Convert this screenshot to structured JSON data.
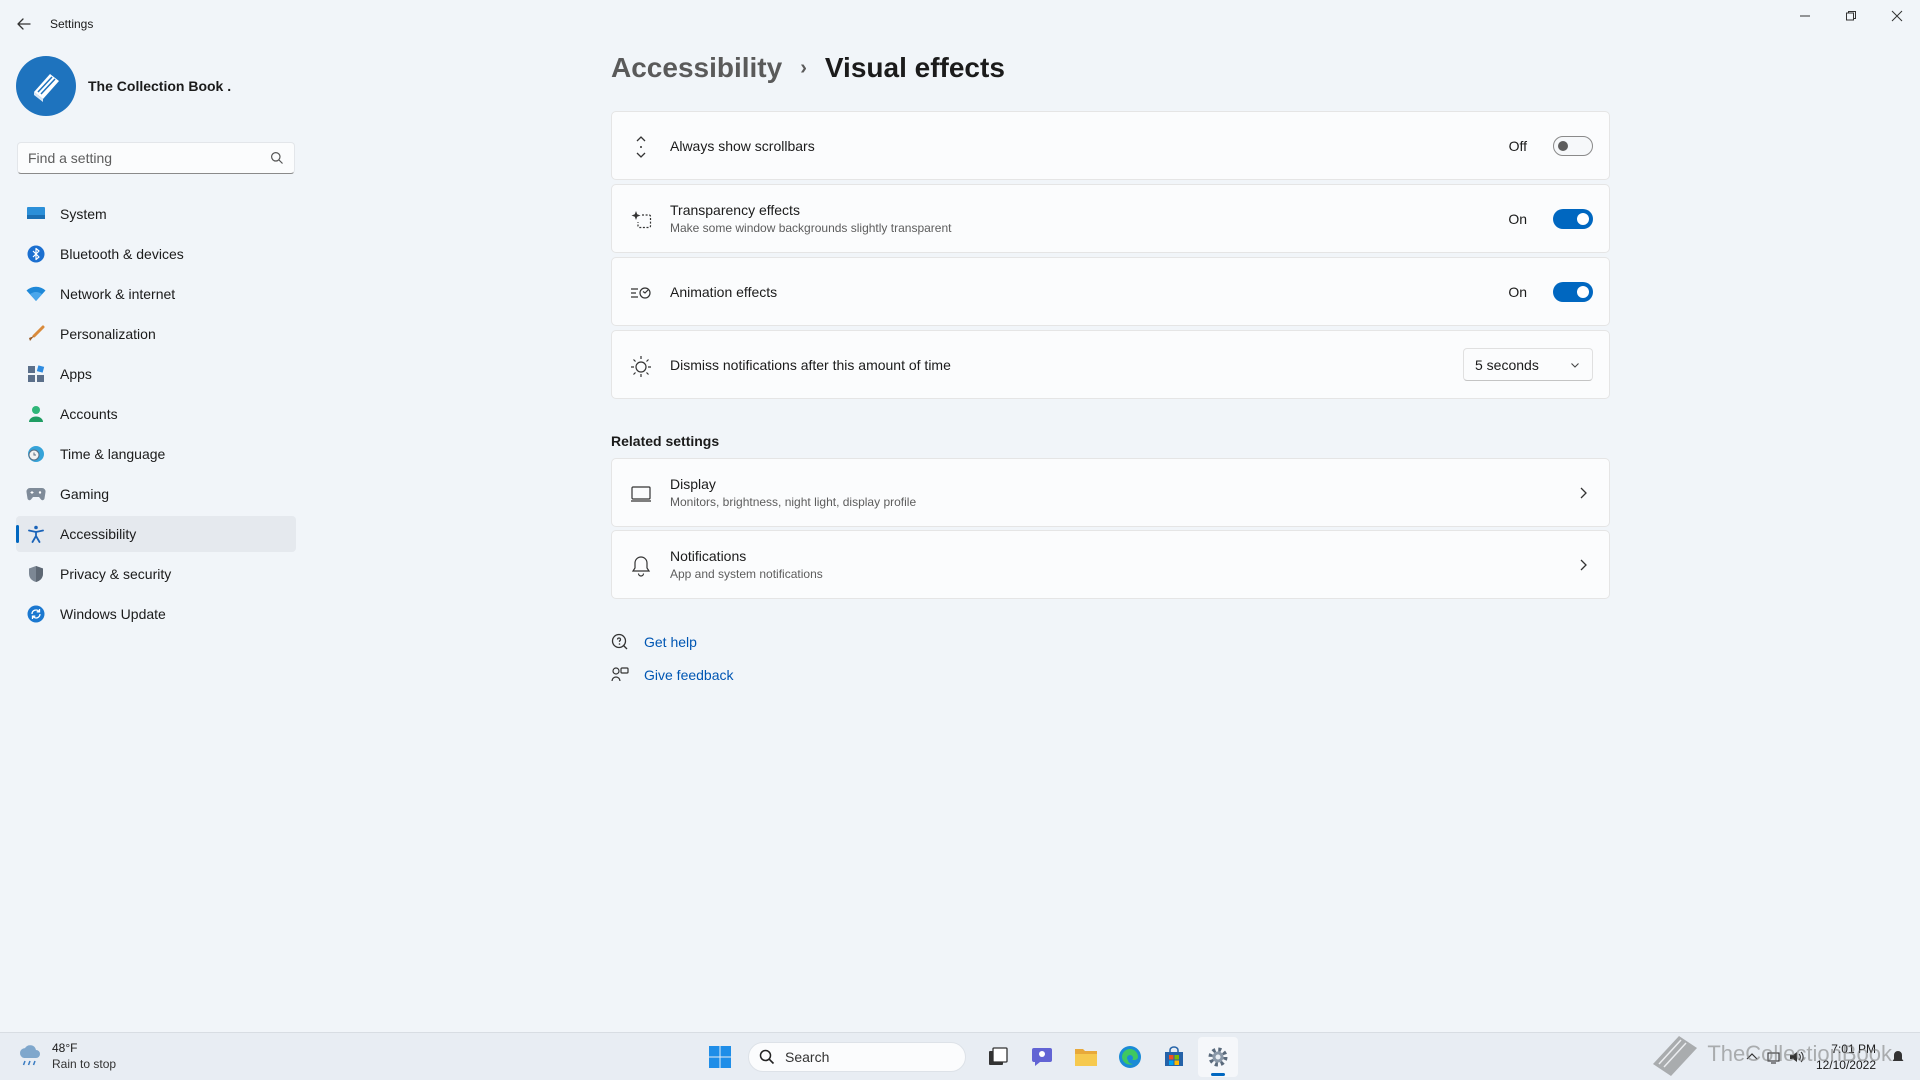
{
  "window": {
    "app_title": "Settings",
    "controls": [
      "minimize-icon",
      "restore-icon",
      "close-icon"
    ]
  },
  "profile": {
    "name": "The Collection Book ."
  },
  "search": {
    "placeholder": "Find a setting"
  },
  "nav": {
    "active": "Accessibility",
    "items": [
      {
        "label": "System",
        "icon": "system-icon"
      },
      {
        "label": "Bluetooth & devices",
        "icon": "bluetooth-icon"
      },
      {
        "label": "Network & internet",
        "icon": "wifi-icon"
      },
      {
        "label": "Personalization",
        "icon": "brush-icon"
      },
      {
        "label": "Apps",
        "icon": "apps-icon"
      },
      {
        "label": "Accounts",
        "icon": "accounts-icon"
      },
      {
        "label": "Time & language",
        "icon": "globe-clock-icon"
      },
      {
        "label": "Gaming",
        "icon": "gamepad-icon"
      },
      {
        "label": "Accessibility",
        "icon": "accessibility-icon"
      },
      {
        "label": "Privacy & security",
        "icon": "shield-icon"
      },
      {
        "label": "Windows Update",
        "icon": "update-icon"
      }
    ]
  },
  "breadcrumb": {
    "parent": "Accessibility",
    "separator": "›",
    "current": "Visual effects"
  },
  "settings": {
    "scrollbars": {
      "title": "Always show scrollbars",
      "state": "Off",
      "enabled": false,
      "icon": "scrollbar-arrows-icon"
    },
    "transparency": {
      "title": "Transparency effects",
      "subtitle": "Make some window backgrounds slightly transparent",
      "state": "On",
      "enabled": true,
      "icon": "transparency-icon"
    },
    "animation": {
      "title": "Animation effects",
      "state": "On",
      "enabled": true,
      "icon": "animation-icon"
    },
    "dismiss": {
      "title": "Dismiss notifications after this amount of time",
      "value": "5 seconds",
      "icon": "sun-timer-icon"
    }
  },
  "related": {
    "heading": "Related settings",
    "display": {
      "title": "Display",
      "subtitle": "Monitors, brightness, night light, display profile",
      "icon": "display-icon"
    },
    "notifications": {
      "title": "Notifications",
      "subtitle": "App and system notifications",
      "icon": "bell-icon"
    }
  },
  "help": {
    "get_help": "Get help",
    "give_feedback": "Give feedback"
  },
  "taskbar": {
    "weather_temp": "48°F",
    "weather_desc": "Rain to stop",
    "search_label": "Search",
    "time": "7:01 PM",
    "date": "12/10/2022",
    "watermark": "TheCollectionBook"
  },
  "colors": {
    "accent": "#0067c0",
    "link": "#0056b3",
    "background": "#f1f5f9",
    "card": "#fbfcfd"
  }
}
